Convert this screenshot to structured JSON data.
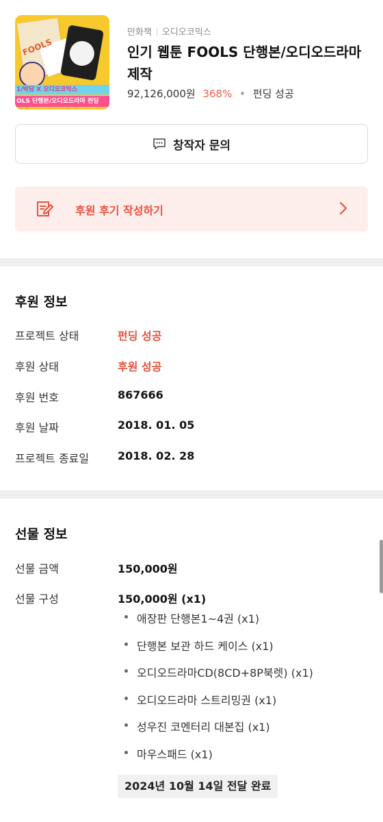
{
  "project": {
    "category_primary": "만화책",
    "category_secondary": "오디오코믹스",
    "title": "인기 웹툰 FOOLS 단행본/오디오드라마 제작",
    "amount": "92,126,000원",
    "percent": "368%",
    "status": "펀딩 성공",
    "thumbnail": {
      "logo_text": "FOOLS",
      "banner_line1": "1/박담 X 오디오코믹스",
      "banner_line2": "OLS 단행본/오디오드라마 펀딩"
    }
  },
  "creator_button": {
    "label": "창작자 문의",
    "icon": "chat-dots-icon"
  },
  "review_banner": {
    "label": "후원 후기 작성하기",
    "icon": "edit-note-icon",
    "arrow": "chevron-right-icon"
  },
  "sponsor_info": {
    "title": "후원 정보",
    "rows": [
      {
        "label": "프로젝트 상태",
        "value": "펀딩 성공"
      },
      {
        "label": "후원 상태",
        "value": "후원 성공"
      },
      {
        "label": "후원 번호",
        "value": "867666"
      },
      {
        "label": "후원 날짜",
        "value": "2018. 01. 05"
      },
      {
        "label": "프로젝트 종료일",
        "value": "2018. 02. 28"
      }
    ]
  },
  "gift_info": {
    "title": "선물 정보",
    "amount_label": "선물 금액",
    "amount_value": "150,000원",
    "composition_label": "선물 구성",
    "composition_value": "150,000원 (x1)",
    "items": [
      "애장판 단행본1~4권 (x1)",
      "단행본 보관 하드 케이스 (x1)",
      "오디오드라마CD(8CD+8P북렛) (x1)",
      "오디오드라마 스트리밍권 (x1)",
      "성우진 코멘터리 대본집 (x1)",
      "마우스패드 (x1)"
    ],
    "delivery_status": "2024년 10월 14일 전달 완료"
  },
  "colors": {
    "accent": "#e8503f",
    "review_bg": "#fdeeec",
    "divider": "#eeeeee"
  }
}
